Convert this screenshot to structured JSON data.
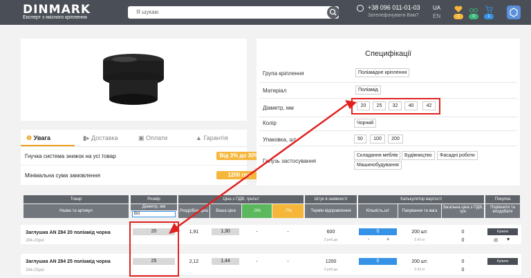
{
  "header": {
    "logo": "DINMARK",
    "tagline": "Експерт з якісного кріплення",
    "search_placeholder": "Я шукаю",
    "phone": "+38 096 011-01-03",
    "callback": "Зателефонувати Вам?",
    "lang_ua": "UA",
    "lang_en": "EN",
    "badges": [
      "2",
      "0",
      "1"
    ]
  },
  "tabs": {
    "items": [
      "Увага",
      "Доставка",
      "Оплати",
      "Гарантія"
    ]
  },
  "notices": [
    {
      "text": "Гнучка система знижок на усі товар",
      "badge": "Від 3% до 30%"
    },
    {
      "text": "Мінімальна сума замовлення",
      "badge": "1200 грн"
    }
  ],
  "specs": {
    "title": "Специфікації",
    "rows": [
      {
        "label": "Група кріплення",
        "values": [
          "Поліамідне кріплення"
        ]
      },
      {
        "label": "Матеріал",
        "values": [
          "Поліамід"
        ]
      },
      {
        "label": "Діаметр, мм",
        "values": [
          "20",
          "25",
          "32",
          "40",
          "42"
        ]
      },
      {
        "label": "Колір",
        "values": [
          "Чорний"
        ]
      },
      {
        "label": "Упаковка, шт.",
        "values": [
          "50",
          "100",
          "200"
        ]
      },
      {
        "label": "Галузь застосування",
        "values": [
          "Складання меблів",
          "Будівництво",
          "Фасадні роботи",
          "Машинобудування"
        ]
      }
    ]
  },
  "table": {
    "headers": {
      "product": "Товар",
      "product_sub": "Назва та артикул",
      "size": "Розмір",
      "size_sub": "Діаметр, мм",
      "size_filter": "Всі",
      "price": "Ціна з ПДВ, грн/шт",
      "retail": "Роздрібна ціна",
      "wholesale": "Ваша ціна",
      "disc1": "-3%",
      "disc2": "-7%",
      "stock": "Штук в наявності",
      "stock_sub": "Термін відправлення",
      "calc": "Калькулятор вартості",
      "qty": "Кількість,шт",
      "pack": "Пакування та вага",
      "total": "Загальна ціна з ПДВ, грн",
      "buy": "Покупка",
      "compare": "Порівняти та вподобати"
    },
    "rows": [
      {
        "name": "Заглушка AN 284 20 поліамід чорна",
        "sku": "284-20pol",
        "size": "20",
        "retail": "1,91",
        "wholesale": "1,30",
        "d1": "-",
        "d2": "-",
        "stock": "600",
        "ship": "3 роб.дн",
        "qty": "0",
        "pack": "200 шт.",
        "weight": "0.42 кг",
        "total": "0",
        "total2": "0",
        "buy": "Купити"
      },
      {
        "name": "Заглушка AN 284 25 поліамід чорна",
        "sku": "284-25pol",
        "size": "25",
        "retail": "2,12",
        "wholesale": "1,44",
        "d1": "-",
        "d2": "-",
        "stock": "1200",
        "ship": "3 роб.дн",
        "qty": "0",
        "pack": "200 шт.",
        "weight": "0.42 кг",
        "total": "0",
        "total2": "0",
        "buy": "Купити"
      }
    ]
  },
  "colors": {
    "accent": "#f5b63a",
    "header": "#4a4f57",
    "blue": "#3592e6",
    "annotation": "#e0201e"
  }
}
